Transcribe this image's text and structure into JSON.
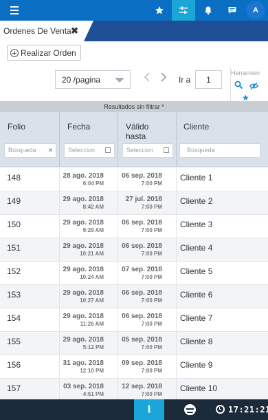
{
  "topbar": {
    "icons": [
      "menu-icon",
      "star-icon",
      "sliders-icon",
      "bell-icon",
      "chat-icon"
    ],
    "avatar_initial": "A",
    "colors": {
      "bar": "#0a6fc2",
      "active": "#1aa6d8"
    }
  },
  "tab": {
    "label": "Ordenes De Venta",
    "close": "✖"
  },
  "toolbar": {
    "new_order_label": "Realizar Orden",
    "per_page_value": "20 /pagina",
    "goto_label": "Ir a",
    "goto_value": "1",
    "tools_label": "Herramien",
    "tools_star": "★"
  },
  "grid": {
    "filter_status": "Resultados sin filtrar *",
    "headers": {
      "folio": "Folio",
      "fecha": "Fecha",
      "valido": "Válido hasta",
      "cliente": "Cliente"
    },
    "filters": {
      "folio_placeholder": "Búsqueda",
      "fecha_placeholder": "Seleccion",
      "valido_placeholder": "Seleccion",
      "cliente_placeholder": "Búsqueda"
    },
    "rows": [
      {
        "folio": "148",
        "fecha_date": "28 ago. 2018",
        "fecha_time": "6:04 PM",
        "valido_date": "06 sep. 2018",
        "valido_time": "7:00 PM",
        "cliente": "Cliente 1"
      },
      {
        "folio": "149",
        "fecha_date": "29 ago. 2018",
        "fecha_time": "8:42 AM",
        "valido_date": "27 jul. 2018",
        "valido_time": "7:00 PM",
        "cliente": "Cliente 2"
      },
      {
        "folio": "150",
        "fecha_date": "29 ago. 2018",
        "fecha_time": "9:29 AM",
        "valido_date": "06 sep. 2018",
        "valido_time": "7:00 PM",
        "cliente": "Cliente 3"
      },
      {
        "folio": "151",
        "fecha_date": "29 ago. 2018",
        "fecha_time": "10:21 AM",
        "valido_date": "06 sep. 2018",
        "valido_time": "7:00 PM",
        "cliente": "Cliente 4"
      },
      {
        "folio": "152",
        "fecha_date": "29 ago. 2018",
        "fecha_time": "10:24 AM",
        "valido_date": "07 sep. 2018",
        "valido_time": "7:00 PM",
        "cliente": "Cliente 5"
      },
      {
        "folio": "153",
        "fecha_date": "29 ago. 2018",
        "fecha_time": "10:27 AM",
        "valido_date": "06 sep. 2018",
        "valido_time": "7:00 PM",
        "cliente": "Cliente 6"
      },
      {
        "folio": "154",
        "fecha_date": "29 ago. 2018",
        "fecha_time": "11:26 AM",
        "valido_date": "06 sep. 2018",
        "valido_time": "7:00 PM",
        "cliente": "Cliente 7"
      },
      {
        "folio": "155",
        "fecha_date": "29 ago. 2018",
        "fecha_time": "5:12 PM",
        "valido_date": "05 sep. 2018",
        "valido_time": "7:00 PM",
        "cliente": "Cliente 8"
      },
      {
        "folio": "156",
        "fecha_date": "31 ago. 2018",
        "fecha_time": "12:10 PM",
        "valido_date": "09 sep. 2018",
        "valido_time": "7:00 PM",
        "cliente": "Cliente 9"
      },
      {
        "folio": "157",
        "fecha_date": "03 sep. 2018",
        "fecha_time": "4:51 PM",
        "valido_date": "12 sep. 2018",
        "valido_time": "7:00 PM",
        "cliente": "Cliente 10"
      }
    ]
  },
  "bottombar": {
    "info_label": "i",
    "time": "17:21:21",
    "icons": [
      "info-icon",
      "mood-icon",
      "clock-icon"
    ]
  }
}
